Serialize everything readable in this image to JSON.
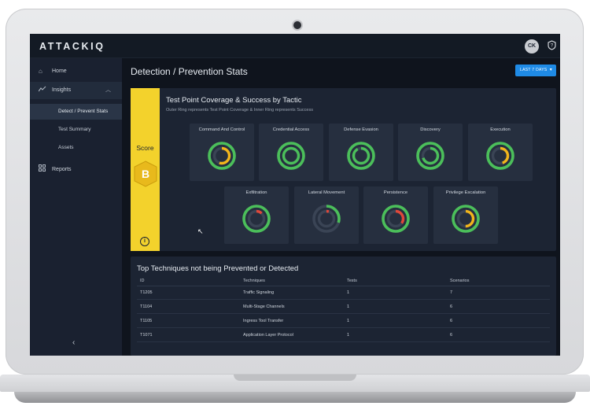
{
  "app": {
    "logo": "ATTACKIQ",
    "user_initials": "CK"
  },
  "sidebar": {
    "home": "Home",
    "insights": "Insights",
    "insights_sub": [
      "Detect / Prevent Stats",
      "Test Summary",
      "Assets"
    ],
    "reports": "Reports"
  },
  "header": {
    "title": "Detection / Prevention Stats",
    "range_button": "LAST 7 DAYS"
  },
  "score": {
    "label": "Score",
    "grade": "B"
  },
  "coverage": {
    "title": "Test Point Coverage & Success by Tactic",
    "subtitle": "Outer Ring represents Test Point Coverage & Inner Ring represents Success",
    "tactics": [
      {
        "name": "Command And Control",
        "outer": 1.0,
        "inner": 0.55,
        "inner_color": "#f2b51b"
      },
      {
        "name": "Credential Access",
        "outer": 1.0,
        "inner": 1.0,
        "inner_color": "#4bbf5a"
      },
      {
        "name": "Defense Evasion",
        "outer": 1.0,
        "inner": 0.92,
        "inner_color": "#4bbf5a"
      },
      {
        "name": "Discovery",
        "outer": 1.0,
        "inner": 0.7,
        "inner_color": "#4bbf5a"
      },
      {
        "name": "Execution",
        "outer": 1.0,
        "inner": 0.45,
        "inner_color": "#f2b51b"
      },
      {
        "name": "Exfiltration",
        "outer": 1.0,
        "inner": 0.12,
        "inner_color": "#e0473a"
      },
      {
        "name": "Lateral Movement",
        "outer": 0.3,
        "inner": 0.05,
        "inner_color": "#e0473a"
      },
      {
        "name": "Persistence",
        "outer": 1.0,
        "inner": 0.35,
        "inner_color": "#e0473a"
      },
      {
        "name": "Privilege Escalation",
        "outer": 1.0,
        "inner": 0.5,
        "inner_color": "#f2b51b"
      }
    ]
  },
  "techniques": {
    "title": "Top Techniques not being Prevented or Detected",
    "headers": [
      "ID",
      "Techniques",
      "Tests",
      "Scenarios"
    ],
    "rows": [
      [
        "T1205",
        "Traffic Signaling",
        "1",
        "7"
      ],
      [
        "T1104",
        "Multi-Stage Channels",
        "1",
        "6"
      ],
      [
        "T1105",
        "Ingress Tool Transfer",
        "1",
        "6"
      ],
      [
        "T1071",
        "Application Layer Protocol",
        "1",
        "6"
      ]
    ]
  },
  "colors": {
    "accent": "#1f8be6",
    "score_yellow": "#f3d22c",
    "ring_green": "#4bbf5a"
  }
}
